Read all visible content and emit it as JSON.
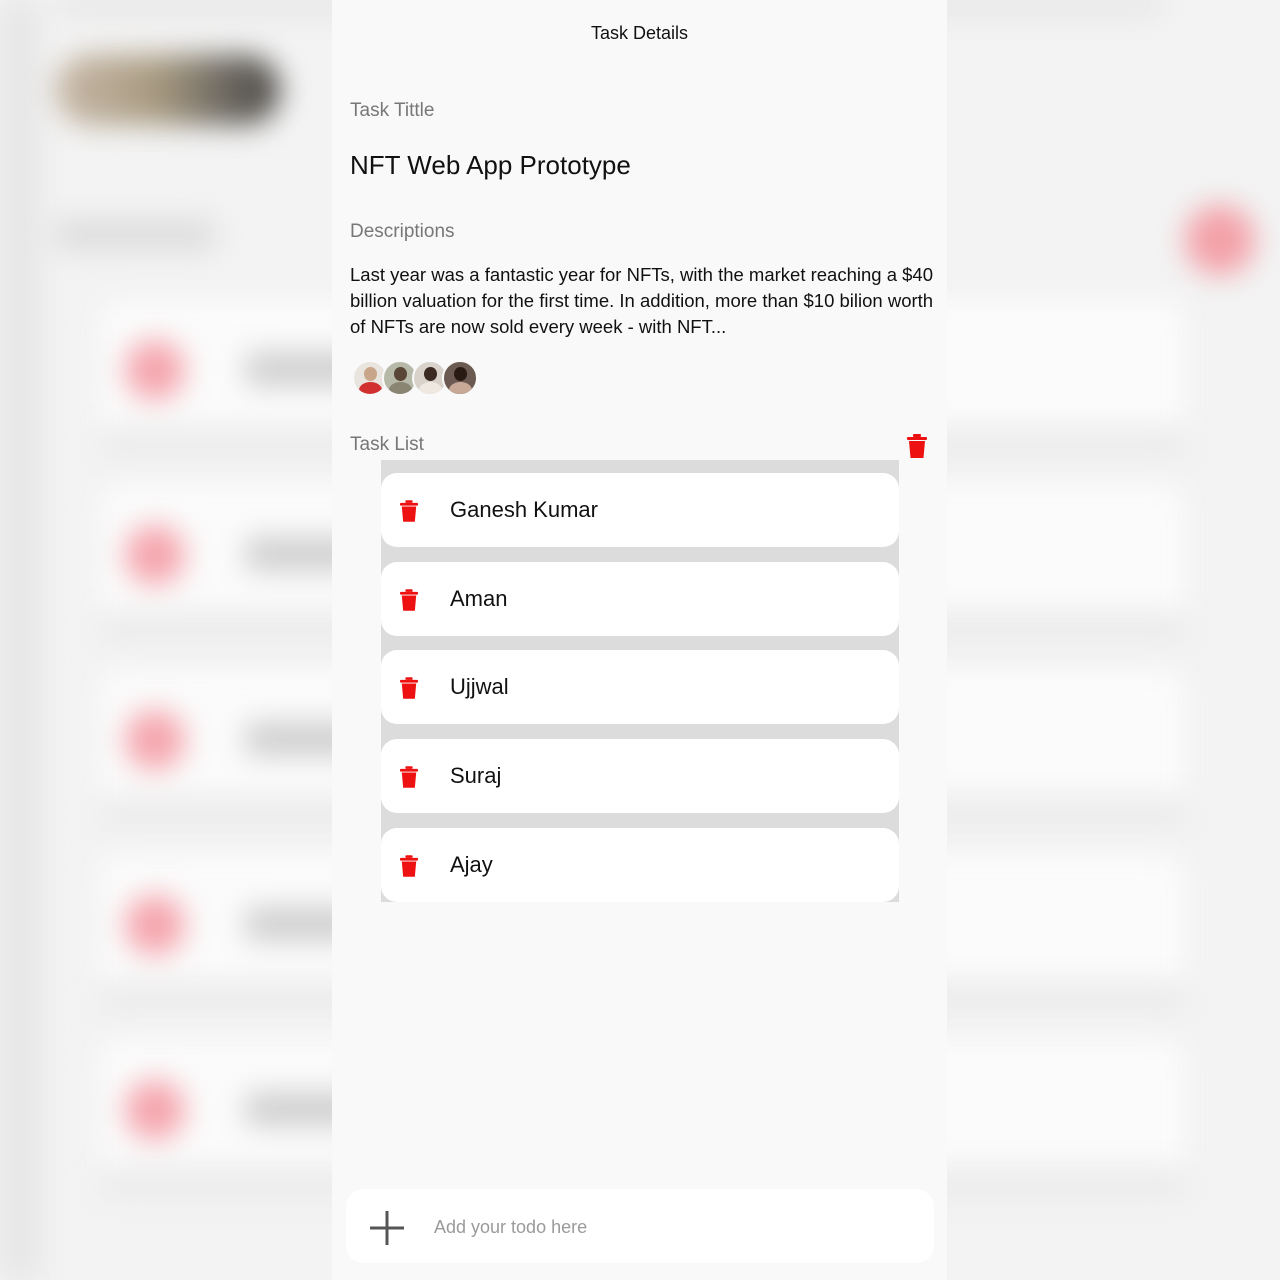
{
  "panel": {
    "title": "Task Details",
    "task_title_label": "Task Tittle",
    "task_title": "NFT Web App Prototype",
    "descriptions_label": "Descriptions",
    "description": "Last year was a fantastic year for NFTs, with the market reaching a $40 billion valuation for the first time. In addition, more than $10 bilion worth of NFTs are now sold every week - with NFT...",
    "assignee_avatars": [
      "avatar-1",
      "avatar-2",
      "avatar-3",
      "avatar-4"
    ],
    "task_list_label": "Task List"
  },
  "tasks": [
    {
      "name": "Ganesh Kumar"
    },
    {
      "name": "Aman"
    },
    {
      "name": "Ujjwal"
    },
    {
      "name": "Suraj"
    },
    {
      "name": "Ajay"
    }
  ],
  "add_todo": {
    "placeholder": "Add your todo here",
    "value": ""
  },
  "icons": {
    "delete": "trash-icon",
    "add": "plus-icon"
  },
  "colors": {
    "accent": "#ee1111",
    "panel_bg": "#f9f9f9",
    "card_bg": "#ffffff"
  }
}
